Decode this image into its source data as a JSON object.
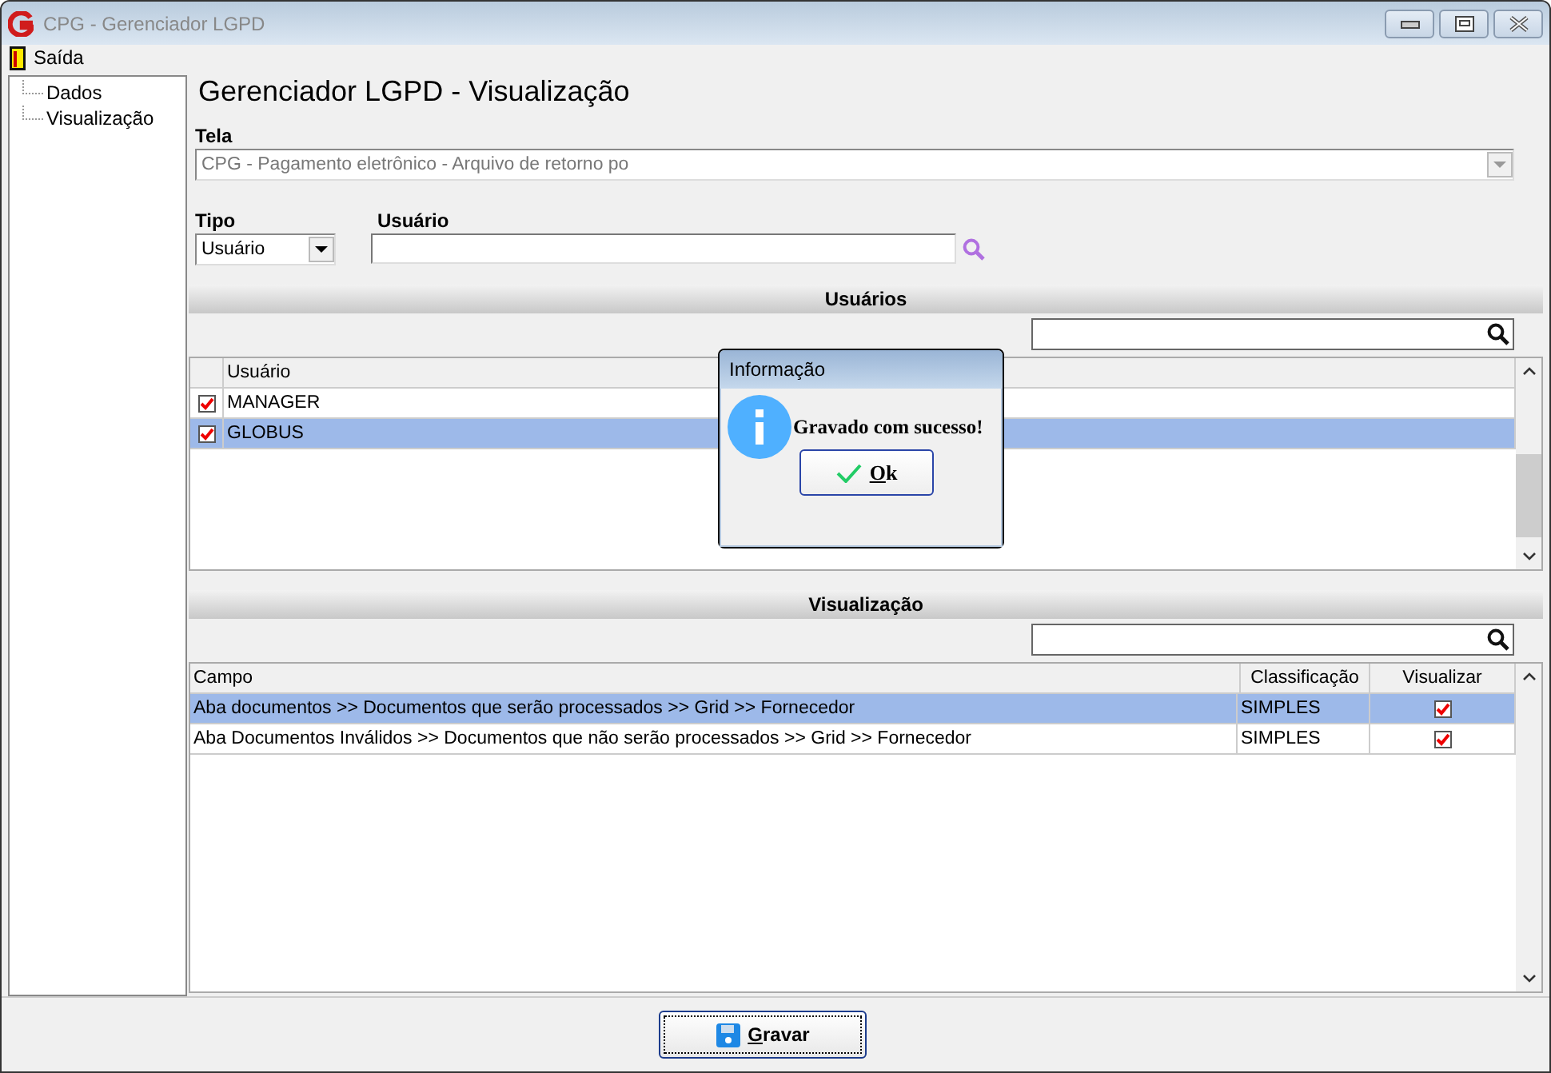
{
  "window": {
    "title": "CPG - Gerenciador LGPD"
  },
  "menu": [
    {
      "label": "Saída"
    }
  ],
  "tree": {
    "items": [
      {
        "label": "Dados"
      },
      {
        "label": "Visualização"
      }
    ]
  },
  "page_title": "Gerenciador LGPD - Visualização",
  "tela": {
    "label": "Tela",
    "value": "CPG - Pagamento eletrônico - Arquivo de retorno po"
  },
  "tipo": {
    "label": "Tipo",
    "value": "Usuário"
  },
  "usuario": {
    "label": "Usuário"
  },
  "users_section": {
    "title": "Usuários",
    "columns": [
      "Usuário"
    ],
    "rows": [
      {
        "name": "MANAGER",
        "checked": true,
        "selected": false
      },
      {
        "name": "GLOBUS",
        "checked": true,
        "selected": true
      }
    ]
  },
  "vis_section": {
    "title": "Visualização",
    "columns": [
      "Campo",
      "Classificação",
      "Visualizar"
    ],
    "rows": [
      {
        "campo": "Aba documentos >> Documentos que serão processados >> Grid >> Fornecedor",
        "classificacao": "SIMPLES",
        "checked": true,
        "selected": true
      },
      {
        "campo": "Aba Documentos Inválidos >> Documentos que não serão processados >> Grid >> Fornecedor",
        "classificacao": "SIMPLES",
        "checked": true,
        "selected": false
      }
    ]
  },
  "dialog": {
    "title": "Informação",
    "message": "Gravado com sucesso!",
    "button": "Ok"
  },
  "save_button": "Gravar"
}
